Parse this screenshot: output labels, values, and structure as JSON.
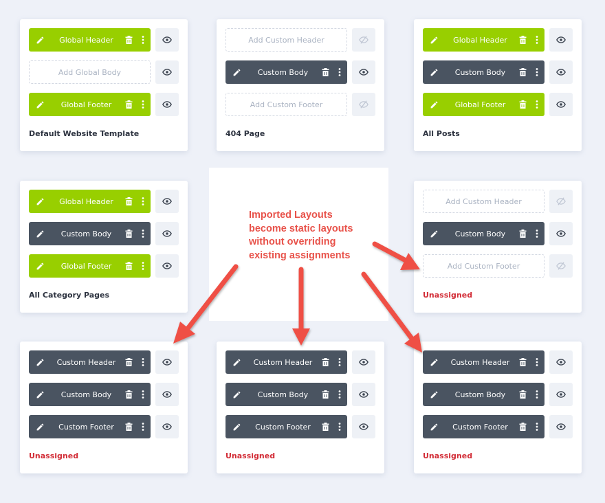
{
  "colors": {
    "global": "#98cf00",
    "custom": "#4a5461",
    "unassigned": "#d22c36",
    "annotation": "#e8524a",
    "background": "#eef1f8"
  },
  "annotation": {
    "lines": [
      "Imported Layouts",
      "become static layouts",
      "without overriding",
      "existing assignments"
    ]
  },
  "templates": [
    {
      "title": "Default Website Template",
      "status": "assigned",
      "slots": [
        {
          "label": "Global Header",
          "style": "green",
          "visible": true
        },
        {
          "label": "Add Global Body",
          "style": "empty",
          "visible": true
        },
        {
          "label": "Global Footer",
          "style": "green",
          "visible": true
        }
      ]
    },
    {
      "title": "404 Page",
      "status": "assigned",
      "slots": [
        {
          "label": "Add Custom Header",
          "style": "empty",
          "visible": false
        },
        {
          "label": "Custom Body",
          "style": "dark",
          "visible": true
        },
        {
          "label": "Add Custom Footer",
          "style": "empty",
          "visible": false
        }
      ]
    },
    {
      "title": "All Posts",
      "status": "assigned",
      "slots": [
        {
          "label": "Global Header",
          "style": "green",
          "visible": true
        },
        {
          "label": "Custom Body",
          "style": "dark",
          "visible": true
        },
        {
          "label": "Global Footer",
          "style": "green",
          "visible": true
        }
      ]
    },
    {
      "title": "All Category Pages",
      "status": "assigned",
      "slots": [
        {
          "label": "Global Header",
          "style": "green",
          "visible": true
        },
        {
          "label": "Custom Body",
          "style": "dark",
          "visible": true
        },
        {
          "label": "Global Footer",
          "style": "green",
          "visible": true
        }
      ]
    },
    {
      "title": "Unassigned",
      "status": "unassigned",
      "slots": [
        {
          "label": "Add Custom Header",
          "style": "empty",
          "visible": false
        },
        {
          "label": "Custom Body",
          "style": "dark",
          "visible": true
        },
        {
          "label": "Add Custom Footer",
          "style": "empty",
          "visible": false
        }
      ]
    },
    {
      "title": "Unassigned",
      "status": "unassigned",
      "slots": [
        {
          "label": "Custom Header",
          "style": "dark",
          "visible": true
        },
        {
          "label": "Custom Body",
          "style": "dark",
          "visible": true
        },
        {
          "label": "Custom Footer",
          "style": "dark",
          "visible": true
        }
      ]
    },
    {
      "title": "Unassigned",
      "status": "unassigned",
      "slots": [
        {
          "label": "Custom Header",
          "style": "dark",
          "visible": true
        },
        {
          "label": "Custom Body",
          "style": "dark",
          "visible": true
        },
        {
          "label": "Custom Footer",
          "style": "dark",
          "visible": true
        }
      ]
    },
    {
      "title": "Unassigned",
      "status": "unassigned",
      "slots": [
        {
          "label": "Custom Header",
          "style": "dark",
          "visible": true
        },
        {
          "label": "Custom Body",
          "style": "dark",
          "visible": true
        },
        {
          "label": "Custom Footer",
          "style": "dark",
          "visible": true
        }
      ]
    }
  ]
}
